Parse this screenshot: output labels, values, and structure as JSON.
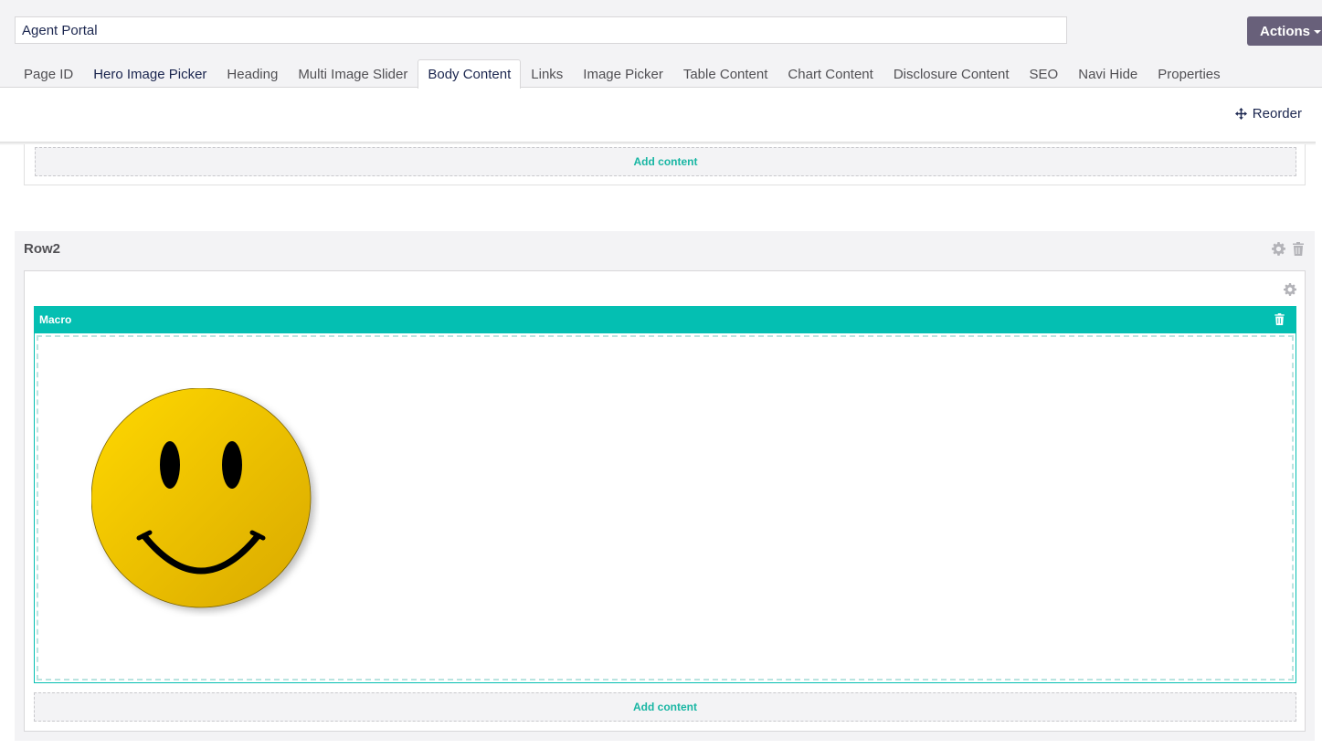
{
  "header": {
    "name_value": "Agent Portal",
    "actions_label": "Actions",
    "tabs": [
      {
        "label": "Page ID"
      },
      {
        "label": "Hero Image Picker"
      },
      {
        "label": "Heading"
      },
      {
        "label": "Multi Image Slider"
      },
      {
        "label": "Body Content"
      },
      {
        "label": "Links"
      },
      {
        "label": "Image Picker"
      },
      {
        "label": "Table Content"
      },
      {
        "label": "Chart Content"
      },
      {
        "label": "Disclosure Content"
      },
      {
        "label": "SEO"
      },
      {
        "label": "Navi Hide"
      },
      {
        "label": "Properties"
      }
    ],
    "active_tab": "Body Content"
  },
  "toolbar": {
    "reorder_label": "Reorder",
    "reorder_icon": "move-icon"
  },
  "row1": {
    "add_content_label": "Add content"
  },
  "row2": {
    "title": "Row2",
    "macro": {
      "label": "Macro",
      "image": "smiley-face"
    },
    "add_content_label": "Add content"
  },
  "colors": {
    "accent_teal": "#04bfb2",
    "actions_button": "#68607a",
    "add_content_text": "#18b6a3",
    "header_bg": "#f3f3f5"
  }
}
